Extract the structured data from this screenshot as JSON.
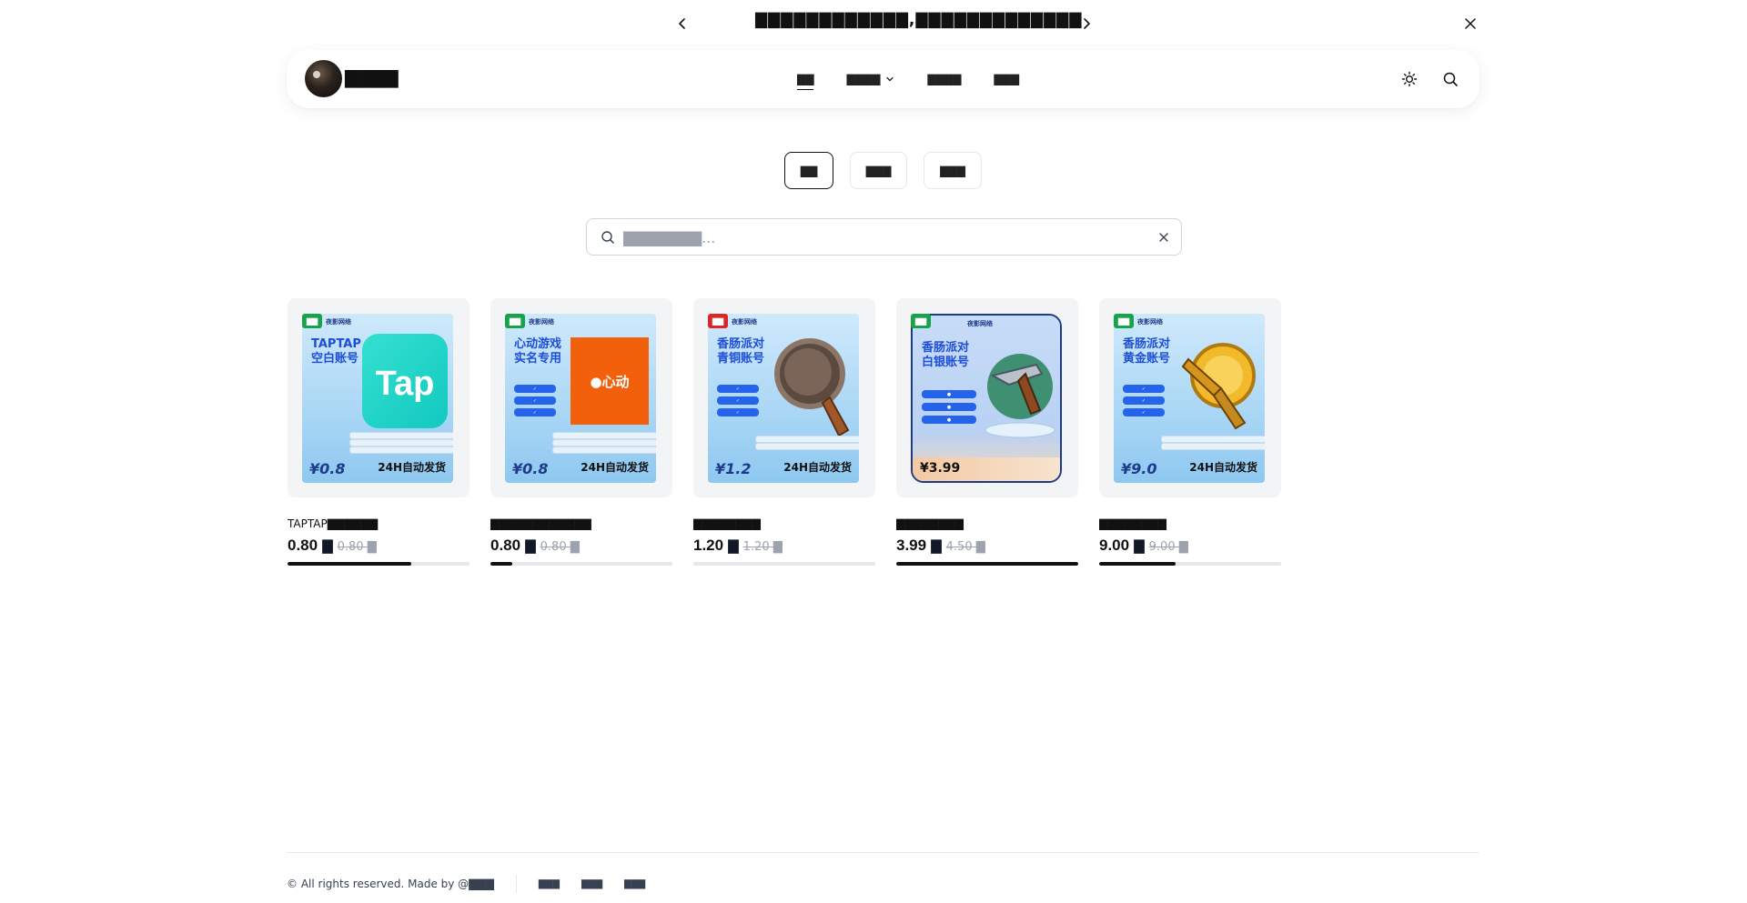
{
  "announcement": {
    "text": "▇▇▇▇▇▇▇▇▇▇▇▇,▇▇▇▇▇▇▇▇▇▇▇▇▇"
  },
  "header": {
    "brand": "▇▇▇▇",
    "nav": [
      {
        "label": "▇▇"
      },
      {
        "label": "▇▇▇▇"
      },
      {
        "label": "▇▇▇▇"
      },
      {
        "label": "▇▇▇"
      }
    ]
  },
  "tabs": [
    {
      "label": "▇▇"
    },
    {
      "label": "▇▇▇"
    },
    {
      "label": "▇▇▇"
    }
  ],
  "search": {
    "placeholder": "▇▇▇▇▇▇▇..."
  },
  "products": [
    {
      "name": "TAPTAP▇▇▇▇▇▇",
      "price": "0.80",
      "currency": "▇",
      "original_price": "0.80 ▇",
      "badge": "▇▇",
      "badge_color": "#16a34a",
      "stock_fraction": 0.68,
      "art": {
        "top": "夜影网络",
        "title": "TAPTAP 空白账号",
        "price": "¥0.8",
        "ship": "24H自动发货",
        "icon": "tap-logo-icon"
      }
    },
    {
      "name": "▇▇▇▇▇▇▇▇▇▇▇▇",
      "price": "0.80",
      "currency": "▇",
      "original_price": "0.80 ▇",
      "badge": "▇▇",
      "badge_color": "#16a34a",
      "stock_fraction": 0.12,
      "art": {
        "top": "夜影网络",
        "title": "心动游戏 实名专用",
        "price": "¥0.8",
        "ship": "24H自动发货",
        "icon": "xd-logo-icon"
      }
    },
    {
      "name": "▇▇▇▇▇▇▇▇",
      "price": "1.20",
      "currency": "▇",
      "original_price": "1.20 ▇",
      "badge": "▇▇",
      "badge_color": "#dc2626",
      "stock_fraction": 0.0,
      "art": {
        "top": "夜影网络",
        "title": "香肠派对 青铜账号",
        "price": "¥1.2",
        "ship": "24H自动发货",
        "icon": "frying-pan-icon"
      }
    },
    {
      "name": "▇▇▇▇▇▇▇▇",
      "price": "3.99",
      "currency": "▇",
      "original_price": "4.50 ▇",
      "badge": "▇▇",
      "badge_color": "#16a34a",
      "stock_fraction": 1.0,
      "art": {
        "top": "夜影网络",
        "title": "香肠派对 白银账号",
        "price": "¥3.99",
        "ship": "",
        "icon": "revolver-icon"
      }
    },
    {
      "name": "▇▇▇▇▇▇▇▇",
      "price": "9.00",
      "currency": "▇",
      "original_price": "9.00 ▇",
      "badge": "▇▇",
      "badge_color": "#16a34a",
      "stock_fraction": 0.42,
      "art": {
        "top": "夜影网络",
        "title": "香肠派对 黄金账号",
        "price": "¥9.0",
        "ship": "24H自动发货",
        "icon": "golden-pan-icon"
      }
    }
  ],
  "footer": {
    "copyright": "© All rights reserved. Made by @▇▇▇",
    "links": [
      {
        "label": "▇▇▇"
      },
      {
        "label": "▇▇▇"
      },
      {
        "label": "▇▇▇"
      }
    ]
  }
}
